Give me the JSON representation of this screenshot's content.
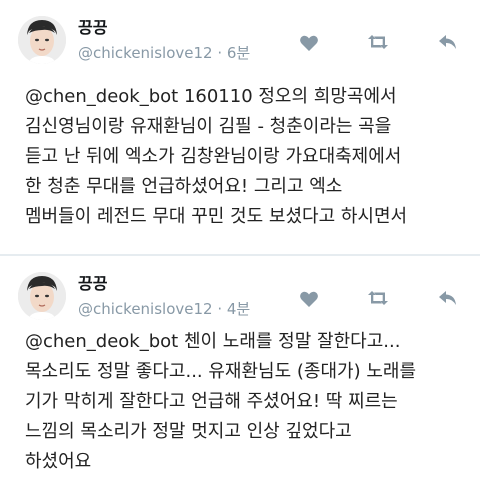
{
  "colors": {
    "action_icon": "#8899a6",
    "divider": "#e6ecf0",
    "meta": "#8899a6"
  },
  "tweets": [
    {
      "display_name": "끙끙",
      "meta": "@chickenislove12 · 6분",
      "text": "@chen_deok_bot 160110 정오의 희망곡에서\n김신영님이랑 유재환님이 김필 - 청춘이라는 곡을\n듣고 난 뒤에 엑소가 김창완님이랑 가요대축제에서\n한 청춘 무대를 언급하셨어요! 그리고 엑소\n멤버들이 레전드 무대 꾸민 것도 보셨다고 하시면서",
      "icons": [
        "heart-icon",
        "retweet-icon",
        "reply-icon"
      ]
    },
    {
      "display_name": "끙끙",
      "meta": "@chickenislove12 · 4분",
      "text": "@chen_deok_bot 첸이 노래를 정말 잘한다고...\n목소리도 정말 좋다고... 유재환님도 (종대가) 노래를\n기가 막히게 잘한다고 언급해 주셨어요! 딱 찌르는\n느낌의 목소리가 정말 멋지고 인상 깊었다고\n하셨어요",
      "icons": [
        "heart-icon",
        "retweet-icon",
        "reply-icon"
      ]
    }
  ]
}
